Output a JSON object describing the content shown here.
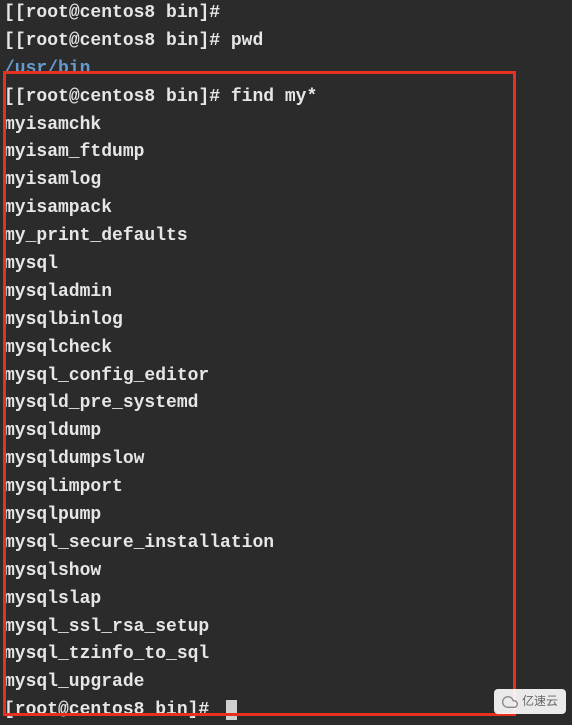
{
  "terminal": {
    "lines": [
      {
        "prompt": "[root@centos8 bin]# ",
        "cmd": "",
        "bracket": true
      },
      {
        "prompt": "[root@centos8 bin]# ",
        "cmd": "pwd",
        "bracket": true
      },
      {
        "path": "/usr/bin"
      },
      {
        "prompt": "[root@centos8 bin]# ",
        "cmd": "find my*",
        "bracket": true
      },
      {
        "output": "myisamchk"
      },
      {
        "output": "myisam_ftdump"
      },
      {
        "output": "myisamlog"
      },
      {
        "output": "myisampack"
      },
      {
        "output": "my_print_defaults"
      },
      {
        "output": "mysql"
      },
      {
        "output": "mysqladmin"
      },
      {
        "output": "mysqlbinlog"
      },
      {
        "output": "mysqlcheck"
      },
      {
        "output": "mysql_config_editor"
      },
      {
        "output": "mysqld_pre_systemd"
      },
      {
        "output": "mysqldump"
      },
      {
        "output": "mysqldumpslow"
      },
      {
        "output": "mysqlimport"
      },
      {
        "output": "mysqlpump"
      },
      {
        "output": "mysql_secure_installation"
      },
      {
        "output": "mysqlshow"
      },
      {
        "output": "mysqlslap"
      },
      {
        "output": "mysql_ssl_rsa_setup"
      },
      {
        "output": "mysql_tzinfo_to_sql"
      },
      {
        "output": "mysql_upgrade"
      },
      {
        "prompt": "[root@centos8 bin]# ",
        "cmd": "",
        "cursor": true
      }
    ]
  },
  "watermark": {
    "text": "亿速云"
  }
}
